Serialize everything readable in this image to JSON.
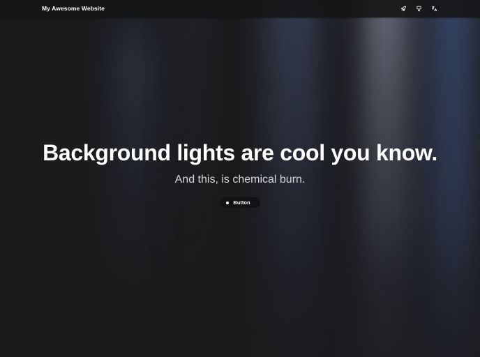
{
  "navbar": {
    "brand": "My Awesome Website",
    "icons": [
      {
        "name": "rocket-icon"
      },
      {
        "name": "brush-icon"
      },
      {
        "name": "translate-icon"
      }
    ]
  },
  "hero": {
    "title": "Background lights are cool you know.",
    "subtitle": "And this, is chemical burn.",
    "button_label": "Button"
  },
  "colors": {
    "background": "#1b1b1d",
    "navbar": "#141416",
    "text": "#ffffff",
    "button": "#121214"
  }
}
